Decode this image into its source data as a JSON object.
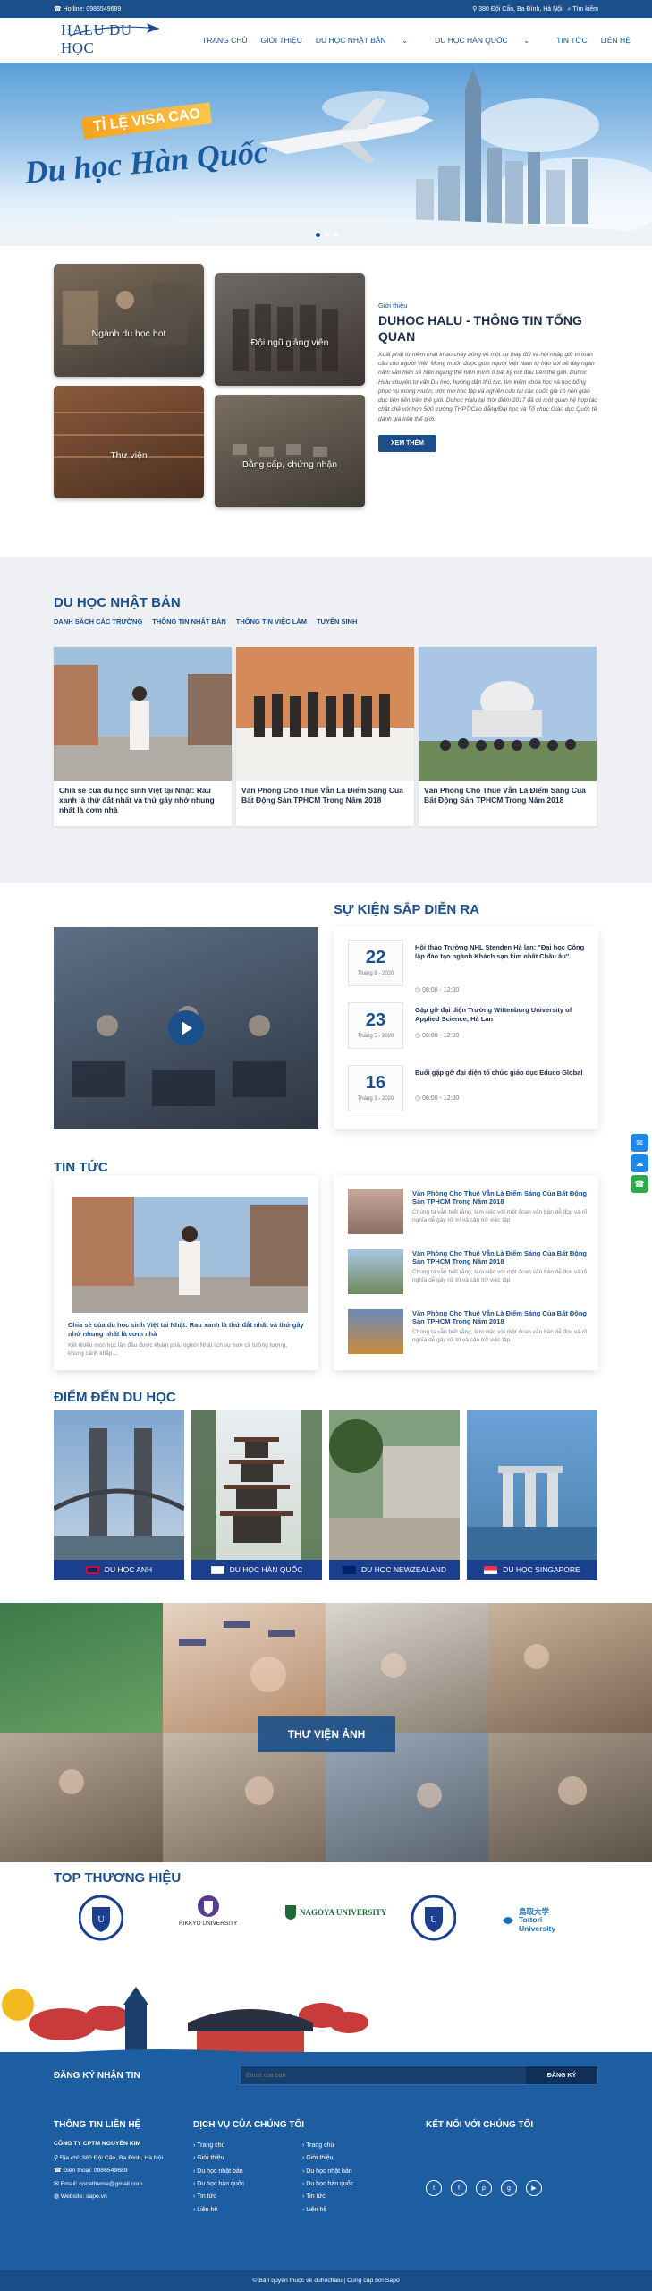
{
  "topbar": {
    "hotline": "Hotline: 0986549689",
    "address": "380 Đội Cấn, Ba Đình, Hà Nội",
    "search": "Tìm kiếm"
  },
  "brand": {
    "logo_text": "HALU DU HỌC"
  },
  "nav": [
    "TRANG CHỦ",
    "GIỚI THIỆU",
    "DU HỌC NHẬT BẢN",
    "DU HỌC HÀN QUỐC",
    "TIN TỨC",
    "LIÊN HỆ"
  ],
  "hero": {
    "badge": "TỈ LỆ VISA CAO",
    "title": "Du học Hàn Quốc"
  },
  "intro": {
    "tiles": [
      "Ngành du học hot",
      "Đội ngũ giảng viên",
      "Thư viện",
      "Bằng cấp, chứng nhận"
    ],
    "kicker": "Giới thiệu",
    "title": "DUHOC HALU - THÔNG TIN TỔNG QUAN",
    "text": "Xuất phát từ niềm khát khao cháy bỏng về một sự thay đổi và hội nhập giữ tri toàn cầu cho người Việt. Mong muốn được giúp người Việt Nam tự hào với bề dày ngàn năm văn hiến sẽ hiên ngang thể hiện mình ở bất kỳ nơi đâu trên thế giới. Duhoc Halu chuyên tư vấn Du học, hướng dẫn thủ tục, tìm kiếm khóa học và học bổng phục vụ mong muốn, ước mơ học tập và nghiên cứu tại các quốc gia có nền giáo dục tiên tiến trên thế giới. Duhoc Halu tại thời điểm 2017 đã có một quan hệ hợp tác chặt chẽ với hơn 500 trường THPT/Cao đẳng/Đại học và Tổ chức Giáo dục Quốc tế danh giá trên thế giới.",
    "button": "XEM THÊM"
  },
  "japan": {
    "title": "DU HỌC NHẬT BẢN",
    "tabs": [
      "DANH SÁCH CÁC TRƯỜNG",
      "THÔNG TIN NHẬT BẢN",
      "THÔNG TIN VIỆC LÀM",
      "TUYỂN SINH"
    ],
    "cards": [
      "Chia sẻ của du học sinh Việt tại Nhật: Rau xanh là thứ đắt nhất và thứ gây nhớ nhung nhất là cơm nhà",
      "Văn Phòng Cho Thuê Vẫn Là Điểm Sáng Của Bất Động Sản TPHCM Trong Năm 2018",
      "Văn Phòng Cho Thuê Vẫn Là Điểm Sáng Của Bất Động Sản TPHCM Trong Năm 2018"
    ]
  },
  "events": {
    "title": "SỰ KIỆN SẮP DIỄN RA",
    "items": [
      {
        "day": "22",
        "month": "Tháng 8 - 2020",
        "title": "Hội thảo Trường NHL Stenden Hà lan: \"Đại học Công lập đào tạo ngành Khách sạn kim nhất Châu âu\"",
        "time": "08:00 - 12:00"
      },
      {
        "day": "23",
        "month": "Tháng 5 - 2020",
        "title": "Gặp gỡ đại diện Trường Wittenburg University of Applied Science, Hà Lan",
        "time": "08:00 - 12:00"
      },
      {
        "day": "16",
        "month": "Tháng 3 - 2020",
        "title": "Buổi gặp gỡ đại diện tổ chức giáo dục Educo Global",
        "time": "08:00 - 12:00"
      }
    ]
  },
  "news": {
    "title": "TIN TỨC",
    "main_title": "Chia sẻ của du học sinh Việt tại Nhật: Rau xanh là thứ đắt nhất và thứ gây nhớ nhung nhất là cơm nhà",
    "main_desc": "Kết nhiều món học lần đầu được khám phá, người Nhật lịch sự hơn cả tưởng tượng, khung cảnh khắp ...",
    "side": [
      {
        "title": "Văn Phòng Cho Thuê Vẫn Là Điểm Sáng Của Bất Động Sản TPHCM Trong Năm 2018",
        "desc": "Chúng ta vẫn biết rằng, làm việc với một đoạn văn bản dễ đọc và rõ nghĩa dễ gây rối trí và cản trở việc tập"
      },
      {
        "title": "Văn Phòng Cho Thuê Vẫn Là Điểm Sáng Của Bất Động Sản TPHCM Trong Năm 2018",
        "desc": "Chúng ta vẫn biết rằng, làm việc với một đoạn văn bản dễ đọc và rõ nghĩa dễ gây rối trí và cản trở việc tập"
      },
      {
        "title": "Văn Phòng Cho Thuê Vẫn Là Điểm Sáng Của Bất Động Sản TPHCM Trong Năm 2018",
        "desc": "Chúng ta vẫn biết rằng, làm việc với một đoạn văn bản dễ đọc và rõ nghĩa dễ gây rối trí và cản trở việc tập"
      }
    ]
  },
  "destinations": {
    "title": "ĐIỂM ĐẾN DU HỌC",
    "items": [
      "DU HỌC ANH",
      "DU HỌC HÀN QUỐC",
      "DU HỌC NEWZEALAND",
      "DU HỌC SINGAPORE"
    ]
  },
  "gallery": {
    "title": "THƯ VIỆN ẢNH"
  },
  "brands": {
    "title": "TOP THƯƠNG HIỆU",
    "items": [
      "RIKKYO UNIVERSITY",
      "NAGOYA UNIVERSITY",
      "鳥取大学 Tottori University"
    ]
  },
  "footer": {
    "newsletter_title": "ĐĂNG KÝ NHẬN TIN",
    "email_placeholder": "Email của bạn",
    "subscribe": "ĐĂNG KÝ",
    "contact_title": "THÔNG TIN LIÊN HỆ",
    "company": "CÔNG TY CPTM NGUYỄN KIM",
    "address": "Địa chỉ: 380 Đội Cấn, Ba Đình, Hà Nội.",
    "phone": "Điện thoại: 0986549689",
    "email": "Email: cocatheme@gmail.com",
    "website": "Website: sapo.vn",
    "services_title": "DỊCH VỤ CỦA CHÚNG TÔI",
    "col1": [
      "Trang chủ",
      "Giới thiệu",
      "Du học nhật bản",
      "Du học hàn quốc",
      "Tin tức",
      "Liên hệ"
    ],
    "col2": [
      "Trang chủ",
      "Giới thiệu",
      "Du học nhật bản",
      "Du học hàn quốc",
      "Tin tức",
      "Liên hệ"
    ],
    "social_title": "KẾT NỐI VỚI CHÚNG TÔI",
    "copyright": "© Bản quyền thuộc về duhochalu | Cung cấp bởi Sapo"
  }
}
